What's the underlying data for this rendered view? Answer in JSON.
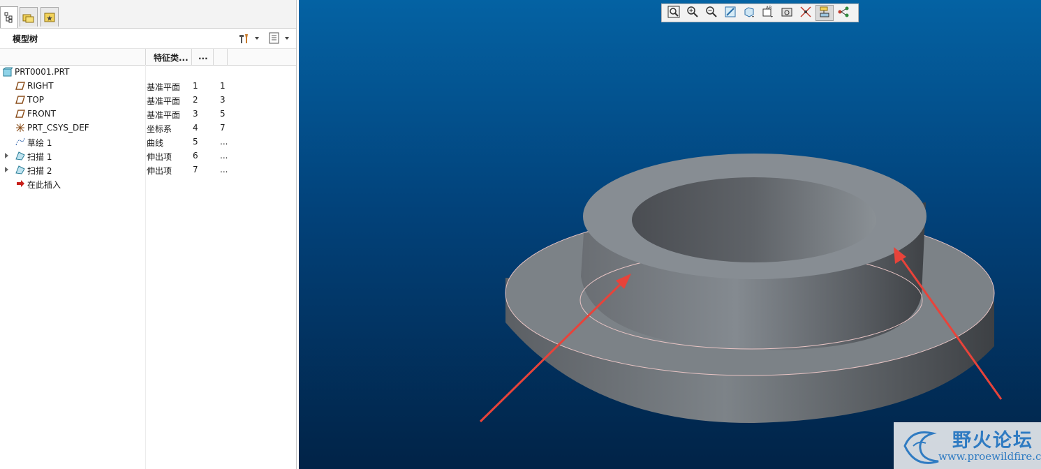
{
  "panel": {
    "title": "模型树",
    "columns": [
      "特征类...",
      "..."
    ]
  },
  "tree": [
    {
      "label": "PRT0001.PRT",
      "type": "",
      "id": "",
      "num": "",
      "icon": "part-icon",
      "expandable": false,
      "indent": 0
    },
    {
      "label": "RIGHT",
      "type": "基准平面",
      "id": "1",
      "num": "1",
      "icon": "datum-plane-icon",
      "expandable": false,
      "indent": 1
    },
    {
      "label": "TOP",
      "type": "基准平面",
      "id": "2",
      "num": "3",
      "icon": "datum-plane-icon",
      "expandable": false,
      "indent": 1
    },
    {
      "label": "FRONT",
      "type": "基准平面",
      "id": "3",
      "num": "5",
      "icon": "datum-plane-icon",
      "expandable": false,
      "indent": 1
    },
    {
      "label": "PRT_CSYS_DEF",
      "type": "坐标系",
      "id": "4",
      "num": "7",
      "icon": "csys-icon",
      "expandable": false,
      "indent": 1
    },
    {
      "label": "草绘 1",
      "type": "曲线",
      "id": "5",
      "num": "...",
      "icon": "sketch-icon",
      "expandable": false,
      "indent": 1
    },
    {
      "label": "扫描 1",
      "type": "伸出项",
      "id": "6",
      "num": "...",
      "icon": "sweep-icon",
      "expandable": true,
      "indent": 1
    },
    {
      "label": "扫描 2",
      "type": "伸出项",
      "id": "7",
      "num": "...",
      "icon": "sweep-icon",
      "expandable": true,
      "indent": 1
    },
    {
      "label": "在此插入",
      "type": "",
      "id": "",
      "num": "",
      "icon": "insert-here-icon",
      "expandable": false,
      "indent": 1
    }
  ],
  "toolbar_icons": [
    "refit-icon",
    "zoom-in-icon",
    "zoom-out-icon",
    "repaint-icon",
    "display-style-icon",
    "saved-views-icon",
    "spin-center-icon",
    "datum-display-icon",
    "model-tree-display-icon",
    "annotation-display-icon"
  ],
  "watermark": {
    "title": "野火论坛",
    "url": "www.proewildfire.cn"
  },
  "colors": {
    "viewport_top": "#0462a3",
    "viewport_bottom": "#012347",
    "arrow": "#e8433a",
    "model": "#7a7f85"
  }
}
